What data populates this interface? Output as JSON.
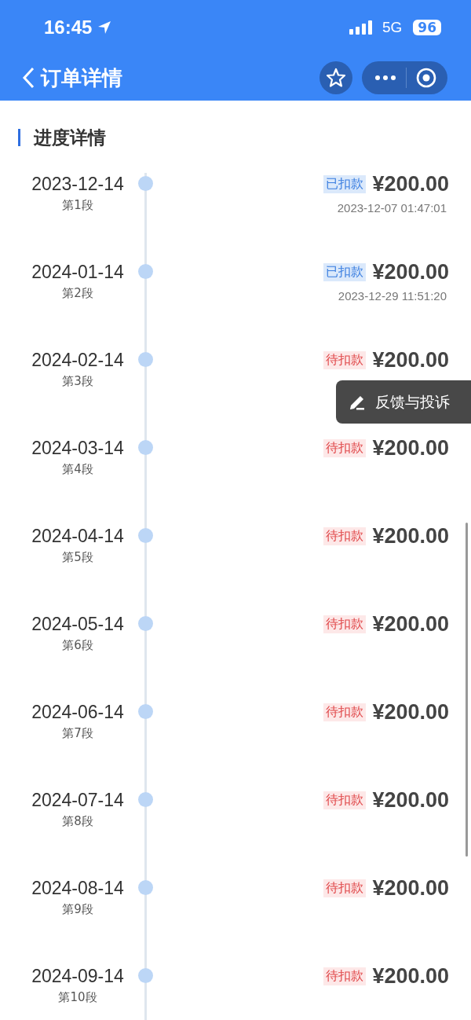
{
  "status_bar": {
    "time": "16:45",
    "network": "5G",
    "battery": "96"
  },
  "nav": {
    "title": "订单详情"
  },
  "section": {
    "title": "进度详情"
  },
  "installments": [
    {
      "date": "2023-12-14",
      "period": "第1段",
      "status": "已扣款",
      "kind": "paid",
      "amount": "¥200.00",
      "paid_at": "2023-12-07 01:47:01"
    },
    {
      "date": "2024-01-14",
      "period": "第2段",
      "status": "已扣款",
      "kind": "paid",
      "amount": "¥200.00",
      "paid_at": "2023-12-29 11:51:20"
    },
    {
      "date": "2024-02-14",
      "period": "第3段",
      "status": "待扣款",
      "kind": "pending",
      "amount": "¥200.00"
    },
    {
      "date": "2024-03-14",
      "period": "第4段",
      "status": "待扣款",
      "kind": "pending",
      "amount": "¥200.00"
    },
    {
      "date": "2024-04-14",
      "period": "第5段",
      "status": "待扣款",
      "kind": "pending",
      "amount": "¥200.00"
    },
    {
      "date": "2024-05-14",
      "period": "第6段",
      "status": "待扣款",
      "kind": "pending",
      "amount": "¥200.00"
    },
    {
      "date": "2024-06-14",
      "period": "第7段",
      "status": "待扣款",
      "kind": "pending",
      "amount": "¥200.00"
    },
    {
      "date": "2024-07-14",
      "period": "第8段",
      "status": "待扣款",
      "kind": "pending",
      "amount": "¥200.00"
    },
    {
      "date": "2024-08-14",
      "period": "第9段",
      "status": "待扣款",
      "kind": "pending",
      "amount": "¥200.00"
    },
    {
      "date": "2024-09-14",
      "period": "第10段",
      "status": "待扣款",
      "kind": "pending",
      "amount": "¥200.00"
    }
  ],
  "feedback_button": {
    "label": "反馈与投诉"
  }
}
